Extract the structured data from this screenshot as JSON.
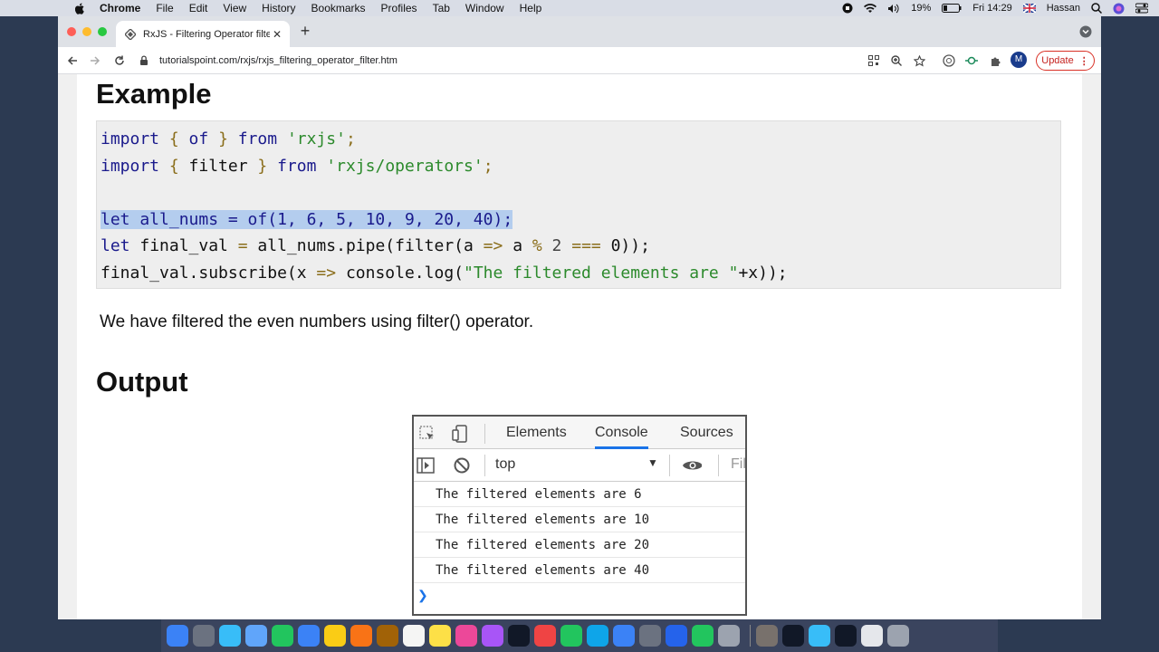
{
  "menubar": {
    "app": "Chrome",
    "items": [
      "File",
      "Edit",
      "View",
      "History",
      "Bookmarks",
      "Profiles",
      "Tab",
      "Window",
      "Help"
    ],
    "battery": "19%",
    "clock": "Fri 14:29",
    "user": "Hassan"
  },
  "browser": {
    "tab_title": "RxJS - Filtering Operator filter",
    "url": "tutorialspoint.com/rxjs/rxjs_filtering_operator_filter.htm",
    "profile_initial": "M",
    "update_label": "Update"
  },
  "page": {
    "example_heading": "Example",
    "code": {
      "l1": {
        "a": "import",
        "b": " { ",
        "c": "of",
        "d": " } ",
        "e": "from",
        "f": " ",
        "g": "'rxjs'",
        "h": ";"
      },
      "l2": {
        "a": "import",
        "b": " { ",
        "c": "filter",
        "d": " } ",
        "e": "from",
        "f": " ",
        "g": "'rxjs/operators'",
        "h": ";"
      },
      "l4": "let all_nums = of(1, 6, 5, 10, 9, 20, 40);",
      "l5": {
        "a": "let",
        "b": " final_val ",
        "c": "=",
        "d": " all_nums.pipe(filter(a ",
        "e": "=>",
        "f": " a ",
        "g": "%",
        "h": " 2 ",
        "i": "===",
        "j": " 0));"
      },
      "l6": {
        "a": "final_val.subscribe(x ",
        "b": "=>",
        "c": " console.log(",
        "d": "\"The filtered elements are \"",
        "e": "+x));"
      }
    },
    "description": "We have filtered the even numbers using filter() operator.",
    "output_heading": "Output"
  },
  "devtools": {
    "tabs": [
      "Elements",
      "Console",
      "Sources"
    ],
    "active_tab": "Console",
    "context": "top",
    "filter_placeholder": "Fil",
    "logs": [
      "The filtered elements are 6",
      "The filtered elements are 10",
      "The filtered elements are 20",
      "The filtered elements are 40"
    ]
  },
  "dock": {
    "colors": [
      "#3b82f6",
      "#6b7280",
      "#38bdf8",
      "#60a5fa",
      "#22c55e",
      "#3b82f6",
      "#facc15",
      "#f97316",
      "#a16207",
      "#f5f5f4",
      "#fde047",
      "#ec4899",
      "#a855f7",
      "#111827",
      "#ef4444",
      "#22c55e",
      "#0ea5e9",
      "#3b82f6",
      "#6b7280",
      "#2563eb",
      "#22c55e",
      "#9ca3af",
      "#78716c",
      "#111827",
      "#38bdf8",
      "#111827",
      "#e5e7eb",
      "#9ca3af"
    ]
  }
}
